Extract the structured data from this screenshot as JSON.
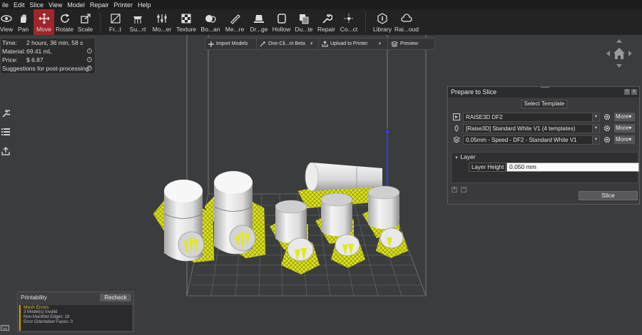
{
  "menubar": [
    "ile",
    "Edit",
    "Slice",
    "View",
    "Model",
    "Repair",
    "Printer",
    "Help"
  ],
  "toolbar": [
    {
      "label": "View",
      "icon": "eye-icon"
    },
    {
      "label": "Pan",
      "icon": "hand-icon"
    },
    {
      "label": "Move",
      "icon": "move-icon",
      "active": true
    },
    {
      "label": "Rotate",
      "icon": "rotate-icon"
    },
    {
      "label": "Scale",
      "icon": "scale-icon"
    },
    {
      "label": "Fr...t",
      "icon": "face-to-plate-icon"
    },
    {
      "label": "Su...rt",
      "icon": "support-icon"
    },
    {
      "label": "Mo...er",
      "icon": "modifier-icon"
    },
    {
      "label": "Texture",
      "icon": "texture-icon"
    },
    {
      "label": "Bo...an",
      "icon": "boolean-icon"
    },
    {
      "label": "Me...re",
      "icon": "measure-icon"
    },
    {
      "label": "Dr...ge",
      "icon": "drop-to-bed-icon"
    },
    {
      "label": "Hollow",
      "icon": "hollow-icon"
    },
    {
      "label": "Du...te",
      "icon": "duplicate-icon"
    },
    {
      "label": "Repair",
      "icon": "repair-icon"
    },
    {
      "label": "Co...ct",
      "icon": "connect-icon"
    },
    {
      "label": "Library",
      "icon": "library-icon"
    },
    {
      "label": "Rai...oud",
      "icon": "cloud-icon"
    }
  ],
  "info": {
    "time_label": "Time:",
    "time_value": "2 hours, 36 min, 58 s",
    "material_label": "Material:",
    "material_value": "69.41 mL",
    "price_label": "Price:",
    "price_value": "$ 6.87",
    "suggestions": "Suggestions for post-processing"
  },
  "centerbar": {
    "import": "Import Models",
    "oneclick": "One-Cli...nt Beta",
    "upload": "Upload to Printer",
    "preview": "Preview"
  },
  "prepare": {
    "title": "Prepare to Slice",
    "select_template": "Select Template",
    "printer": "RAISE3D DF2",
    "material": "[Raise3D] Standard White V1 (4 templates)",
    "profile": "0.05mm - Speed - DF2 - Standard White V1",
    "more": "More",
    "layer_header": "Layer",
    "layer_height_label": "Layer Height",
    "layer_height_value": "0,050 mm",
    "slice": "Slice"
  },
  "printability": {
    "title": "Printability",
    "recheck": "Recheck",
    "mesh_title": "Mesh Errors",
    "line1": "3 Model(s) Invalid",
    "line2": "Non-Manifold Edges: 18",
    "line3": "Error Orientation Faces: 0"
  },
  "colors": {
    "accent": "#a0262c",
    "support": "#e4ea1a",
    "model": "#e9e9e9",
    "warning": "#d9a000"
  }
}
